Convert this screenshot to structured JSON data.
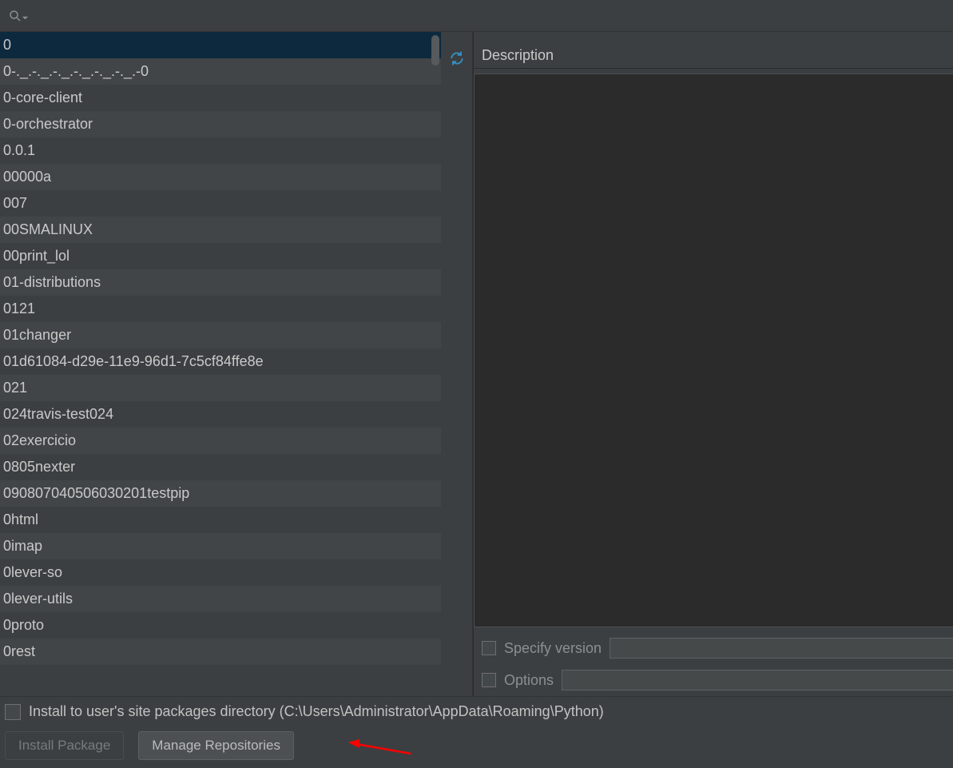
{
  "search": {
    "placeholder": ""
  },
  "packages": [
    "0",
    "0-._.-._.-._.-._.-._.-._.-0",
    "0-core-client",
    "0-orchestrator",
    "0.0.1",
    "00000a",
    "007",
    "00SMALINUX",
    "00print_lol",
    "01-distributions",
    "0121",
    "01changer",
    "01d61084-d29e-11e9-96d1-7c5cf84ffe8e",
    "021",
    "024travis-test024",
    "02exercicio",
    "0805nexter",
    "090807040506030201testpip",
    "0html",
    "0imap",
    "0lever-so",
    "0lever-utils",
    "0proto",
    "0rest"
  ],
  "selected_index": 0,
  "description": {
    "header": "Description"
  },
  "options": {
    "specify_version_label": "Specify version",
    "specify_version_value": "",
    "options_label": "Options",
    "options_value": ""
  },
  "install_to_user": {
    "label": "Install to user's site packages directory (C:\\Users\\Administrator\\AppData\\Roaming\\Python)"
  },
  "buttons": {
    "install_package": "Install Package",
    "manage_repositories": "Manage Repositories"
  }
}
